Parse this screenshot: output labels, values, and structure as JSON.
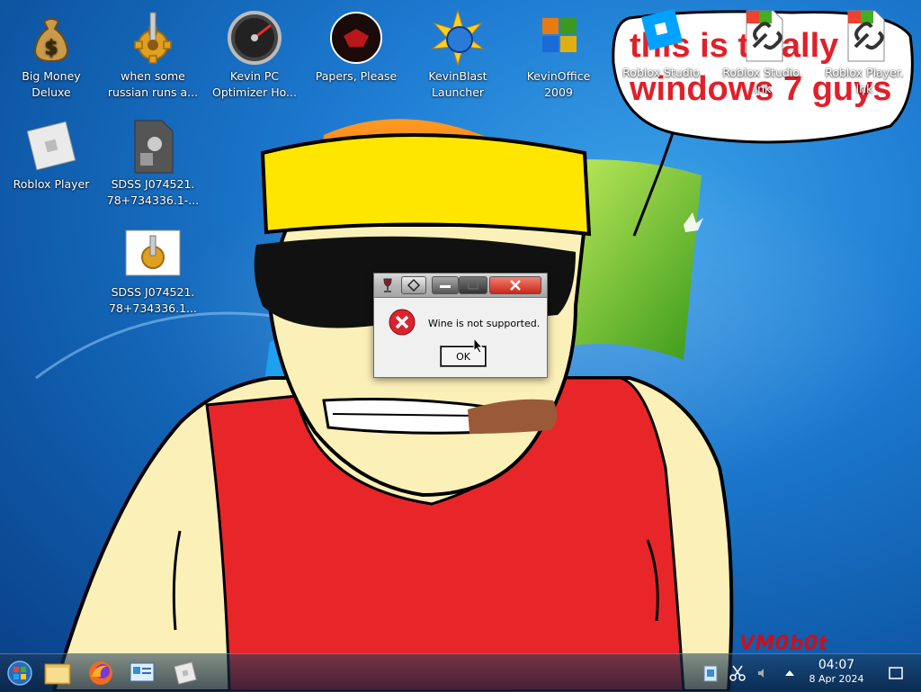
{
  "desktop": {
    "icons": [
      {
        "name": "big-money-deluxe",
        "label": "Big Money Deluxe",
        "icon": "money-bag-icon"
      },
      {
        "name": "russian-runs",
        "label": "when some russian runs a...",
        "icon": "gear-icon"
      },
      {
        "name": "kevin-pc-optimizer",
        "label": "Kevin PC Optimizer Ho...",
        "icon": "gauge-icon"
      },
      {
        "name": "papers-please",
        "label": "Papers, Please",
        "icon": "papers-please-icon"
      },
      {
        "name": "kevinblast-launcher",
        "label": "KevinBlast Launcher",
        "icon": "starburst-icon"
      },
      {
        "name": "kevinoffice-2009",
        "label": "KevinOffice 2009",
        "icon": "office-icon"
      },
      {
        "name": "roblox-studio",
        "label": "Roblox Studio",
        "icon": "roblox-studio-icon"
      },
      {
        "name": "roblox-studio-lnk",
        "label": "Roblox Studio. lnk",
        "icon": "shortcut-icon"
      },
      {
        "name": "roblox-player-lnk",
        "label": "Roblox Player. lnk",
        "icon": "shortcut-icon"
      },
      {
        "name": "roblox-player",
        "label": "Roblox Player",
        "icon": "roblox-icon"
      },
      {
        "name": "sdss-file-1",
        "label": "SDSS J074521. 78+734336.1-...",
        "icon": "file-gear-icon"
      },
      {
        "name": "sdss-file-2",
        "label": "SDSS J074521. 78+734336.1...",
        "icon": "gear-icon"
      }
    ],
    "bubble_text_line1": "this is totally",
    "bubble_text_line2": "windows 7 guys",
    "watermark": "VM0b0t"
  },
  "dialog": {
    "message": "Wine is not supported.",
    "ok_label": "OK"
  },
  "taskbar": {
    "pinned": [
      "start-orb-icon",
      "file-manager-icon",
      "firefox-icon",
      "control-panel-icon",
      "roblox-icon"
    ],
    "clock_time": "04:07",
    "clock_date": "8 Apr 2024"
  },
  "colors": {
    "error_red": "#d9232e",
    "bubble_text": "#e0202a",
    "tank_top": "#e8262a",
    "bandana": "#ffe600",
    "skin": "#fbf0b8"
  }
}
